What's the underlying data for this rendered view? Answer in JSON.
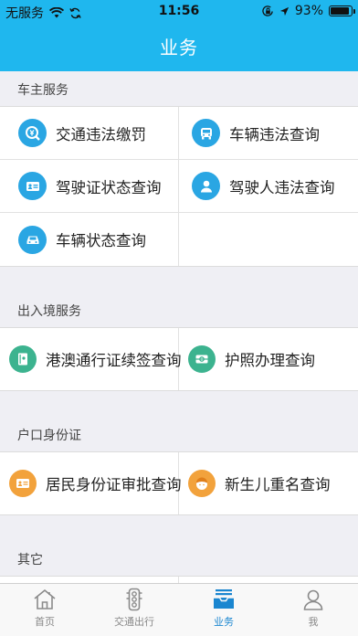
{
  "status_bar": {
    "carrier": "无服务",
    "time": "11:56",
    "battery_percent": "93%",
    "battery_level": 0.93
  },
  "nav": {
    "title": "业务"
  },
  "sections": [
    {
      "title": "车主服务",
      "items": [
        {
          "label": "交通违法缴罚",
          "icon": "traffic-fine-icon",
          "color": "#2aa6e3"
        },
        {
          "label": "车辆违法查询",
          "icon": "car-front-icon",
          "color": "#2aa6e3"
        },
        {
          "label": "驾驶证状态查询",
          "icon": "license-card-icon",
          "color": "#2aa6e3"
        },
        {
          "label": "驾驶人违法查询",
          "icon": "driver-person-icon",
          "color": "#2aa6e3"
        },
        {
          "label": "车辆状态查询",
          "icon": "car-status-icon",
          "color": "#2aa6e3"
        }
      ]
    },
    {
      "title": "出入境服务",
      "items": [
        {
          "label": "港澳通行证续签查询",
          "icon": "permit-book-icon",
          "color": "#3cb38f"
        },
        {
          "label": "护照办理查询",
          "icon": "passport-icon",
          "color": "#3cb38f"
        }
      ]
    },
    {
      "title": "户口身份证",
      "items": [
        {
          "label": "居民身份证审批查询",
          "icon": "id-card-icon",
          "color": "#f2a23c"
        },
        {
          "label": "新生儿重名查询",
          "icon": "baby-face-icon",
          "color": "#f2a23c"
        }
      ]
    },
    {
      "title": "其它",
      "items": []
    }
  ],
  "tabs": [
    {
      "label": "首页",
      "icon": "home-icon",
      "active": false
    },
    {
      "label": "交通出行",
      "icon": "traffic-light-icon",
      "active": false
    },
    {
      "label": "业务",
      "icon": "business-tray-icon",
      "active": true
    },
    {
      "label": "我",
      "icon": "user-icon",
      "active": false
    }
  ]
}
